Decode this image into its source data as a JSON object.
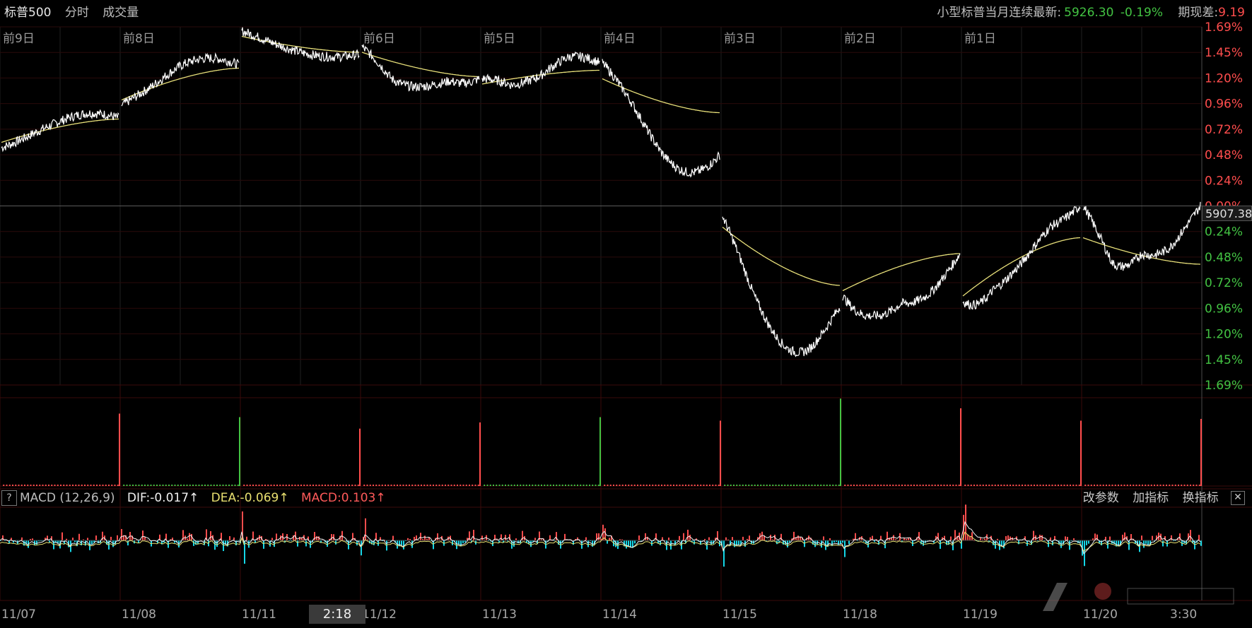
{
  "header": {
    "symbol": "标普500",
    "tab_intraday": "分时",
    "tab_volume": "成交量",
    "contract_label": "小型标普当月连续最新:",
    "contract_price": "5926.30",
    "contract_change": "-0.19%",
    "basis_label": "期现差:",
    "basis_value": "9.19"
  },
  "colors": {
    "up": "#ff4d4d",
    "down": "#43c343",
    "price_line": "#ffffff",
    "avg_line": "#e8e07a",
    "macd_down": "#16d6e6",
    "grid": "#3a0000"
  },
  "day_labels": [
    "前9日",
    "前8日",
    "",
    "前6日",
    "前5日",
    "前4日",
    "前3日",
    "前2日",
    "前1日",
    ""
  ],
  "date_labels": [
    "11/07",
    "11/08",
    "11/11",
    "11/12",
    "11/13",
    "11/14",
    "11/15",
    "11/18",
    "11/19",
    "11/20"
  ],
  "cursor_time": "2:18",
  "last_time": "3:30",
  "current_price_tag": "5907.38",
  "right_axis_upper": [
    "1.69%",
    "1.45%",
    "1.20%",
    "0.96%",
    "0.72%",
    "0.48%",
    "0.24%",
    "0.00%"
  ],
  "right_axis_lower": [
    "0.24%",
    "0.48%",
    "0.72%",
    "0.96%",
    "1.20%",
    "1.45%",
    "1.69%"
  ],
  "macd": {
    "help": "?",
    "name": "MACD (12,26,9)",
    "dif": "DIF:-0.017↑",
    "dea": "DEA:-0.069↑",
    "value": "MACD:0.103↑",
    "btn_params": "改参数",
    "btn_add": "加指标",
    "btn_switch": "换指标",
    "btn_close": "✕"
  },
  "chart_data": {
    "type": "line",
    "x": [
      "11/07",
      "11/08",
      "11/11",
      "11/12",
      "11/13",
      "11/14",
      "11/15",
      "11/18",
      "11/19",
      "11/20"
    ],
    "series": [],
    "yaxis_unit": "%",
    "ylim": [
      -1.69,
      1.69
    ],
    "grid": true,
    "day_shapes": [
      {
        "start": 0.55,
        "end": 0.83,
        "avg_start": 0.6,
        "avg_end": 0.82,
        "wave": [
          0.03,
          0.08,
          0.12,
          0.18,
          0.22
        ]
      },
      {
        "start": 0.95,
        "end": 1.33,
        "avg_start": 1.0,
        "avg_end": 1.3,
        "wave": [
          0.1,
          0.12,
          0.2,
          0.25,
          0.3
        ]
      },
      {
        "start": 1.65,
        "end": 1.43,
        "avg_start": 1.6,
        "avg_end": 1.45,
        "wave": [
          -0.05,
          -0.08,
          -0.1,
          -0.12,
          -0.15
        ]
      },
      {
        "start": 1.5,
        "end": 1.2,
        "avg_start": 1.45,
        "avg_end": 1.22,
        "wave": [
          -0.2,
          -0.35,
          -0.25,
          -0.15,
          -0.3
        ]
      },
      {
        "start": 1.2,
        "end": 1.35,
        "avg_start": 1.15,
        "avg_end": 1.28,
        "wave": [
          -0.05,
          -0.15,
          -0.05,
          0.15,
          0.25
        ]
      },
      {
        "start": 1.35,
        "end": 0.48,
        "avg_start": 1.2,
        "avg_end": 0.88,
        "wave": [
          -0.1,
          -0.25,
          -0.45,
          -0.6,
          -0.75
        ]
      },
      {
        "start": -0.1,
        "end": -0.95,
        "avg_start": -0.2,
        "avg_end": -0.75,
        "wave": [
          -0.5,
          -0.75,
          -0.85,
          -0.95,
          -0.9
        ]
      },
      {
        "start": -0.85,
        "end": -0.45,
        "avg_start": -0.8,
        "avg_end": -0.45,
        "wave": [
          -0.7,
          -0.45,
          -0.3,
          -0.42,
          -0.45
        ]
      },
      {
        "start": -0.9,
        "end": 0.0,
        "avg_start": -0.85,
        "avg_end": -0.3,
        "wave": [
          -0.6,
          -0.2,
          -0.1,
          0.05,
          -0.05
        ]
      },
      {
        "start": 0.0,
        "end": 0.0,
        "avg_start": -0.3,
        "avg_end": -0.55,
        "wave": [
          -0.6,
          -0.85,
          -0.5,
          -0.6,
          -0.55
        ]
      }
    ],
    "volume_spikes": [
      {
        "day": 0,
        "dir": "up",
        "level": 0.82
      },
      {
        "day": 1,
        "dir": "down",
        "level": 0.78
      },
      {
        "day": 2,
        "dir": "up",
        "level": 0.65
      },
      {
        "day": 3,
        "dir": "up",
        "level": 0.72
      },
      {
        "day": 4,
        "dir": "down",
        "level": 0.78
      },
      {
        "day": 5,
        "dir": "up",
        "level": 0.74
      },
      {
        "day": 6,
        "dir": "down",
        "level": 0.99
      },
      {
        "day": 7,
        "dir": "up",
        "level": 0.88
      },
      {
        "day": 8,
        "dir": "up",
        "level": 0.74
      },
      {
        "day": 9,
        "dir": "up",
        "level": 0.76
      }
    ]
  }
}
